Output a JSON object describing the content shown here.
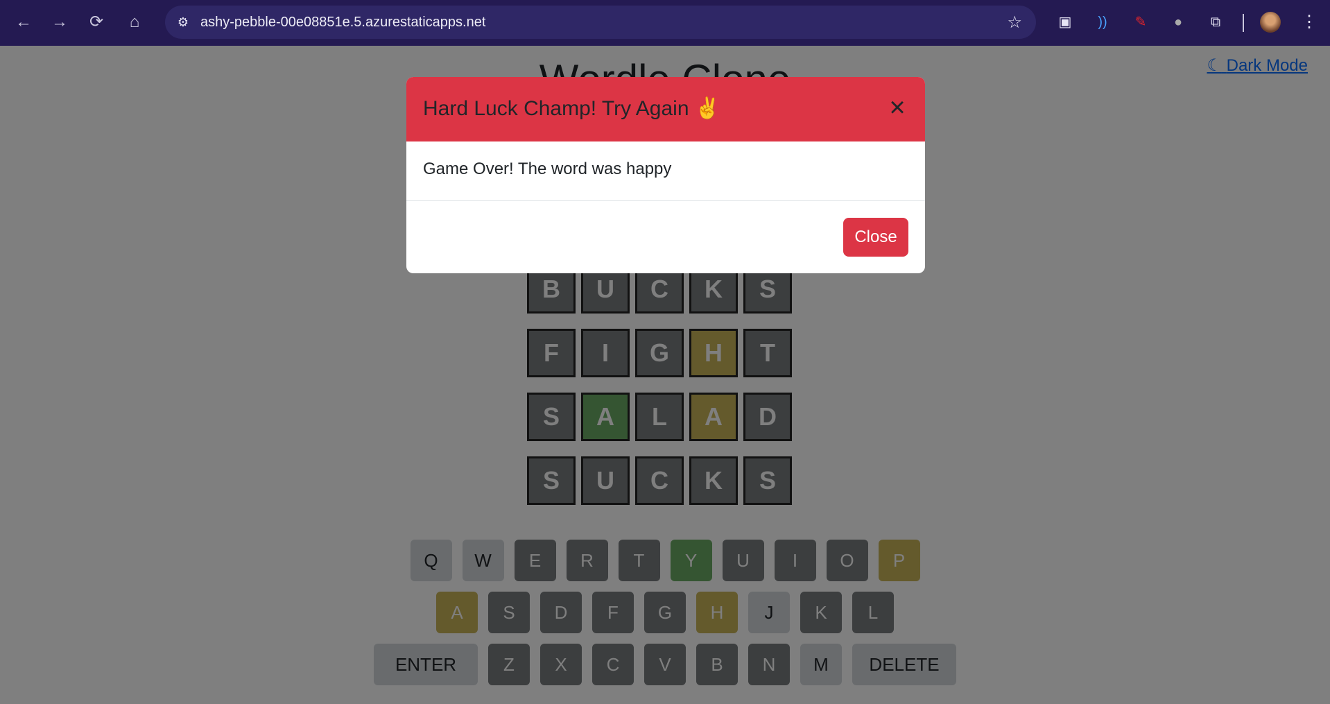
{
  "browser": {
    "url": "ashy-pebble-00e08851e.5.azurestaticapps.net",
    "icons": [
      "back-icon",
      "forward-icon",
      "reload-icon",
      "home-icon",
      "site-info-icon",
      "bookmark-star-icon",
      "picture-in-picture-icon",
      "read-aloud-icon",
      "pen-extension-icon",
      "bug-extension-icon",
      "extensions-puzzle-icon",
      "profile-avatar",
      "menu-kebab-icon"
    ]
  },
  "page": {
    "title": "Wordle Clone",
    "dark_mode_label": "Dark Mode"
  },
  "board": {
    "rows": [
      {
        "letters": [
          "B",
          "U",
          "C",
          "K",
          "S"
        ],
        "states": [
          "absent",
          "absent",
          "absent",
          "absent",
          "absent"
        ]
      },
      {
        "letters": [
          "F",
          "I",
          "G",
          "H",
          "T"
        ],
        "states": [
          "absent",
          "absent",
          "absent",
          "present",
          "absent"
        ]
      },
      {
        "letters": [
          "S",
          "A",
          "L",
          "A",
          "D"
        ],
        "states": [
          "absent",
          "correct",
          "absent",
          "present",
          "absent"
        ]
      },
      {
        "letters": [
          "S",
          "U",
          "C",
          "K",
          "S"
        ],
        "states": [
          "absent",
          "absent",
          "absent",
          "absent",
          "absent"
        ]
      }
    ]
  },
  "keyboard": {
    "rows": [
      [
        {
          "k": "Q",
          "s": "unused"
        },
        {
          "k": "W",
          "s": "unused"
        },
        {
          "k": "E",
          "s": "absent"
        },
        {
          "k": "R",
          "s": "absent"
        },
        {
          "k": "T",
          "s": "absent"
        },
        {
          "k": "Y",
          "s": "correct"
        },
        {
          "k": "U",
          "s": "absent"
        },
        {
          "k": "I",
          "s": "absent"
        },
        {
          "k": "O",
          "s": "absent"
        },
        {
          "k": "P",
          "s": "present"
        }
      ],
      [
        {
          "k": "A",
          "s": "present"
        },
        {
          "k": "S",
          "s": "absent"
        },
        {
          "k": "D",
          "s": "absent"
        },
        {
          "k": "F",
          "s": "absent"
        },
        {
          "k": "G",
          "s": "absent"
        },
        {
          "k": "H",
          "s": "present"
        },
        {
          "k": "J",
          "s": "unused"
        },
        {
          "k": "K",
          "s": "absent"
        },
        {
          "k": "L",
          "s": "absent"
        }
      ],
      [
        {
          "k": "ENTER",
          "s": "unused",
          "wide": true
        },
        {
          "k": "Z",
          "s": "absent"
        },
        {
          "k": "X",
          "s": "absent"
        },
        {
          "k": "C",
          "s": "absent"
        },
        {
          "k": "V",
          "s": "absent"
        },
        {
          "k": "B",
          "s": "absent"
        },
        {
          "k": "N",
          "s": "absent"
        },
        {
          "k": "M",
          "s": "unused"
        },
        {
          "k": "DELETE",
          "s": "unused",
          "wide": true
        }
      ]
    ]
  },
  "modal": {
    "title": "Hard Luck Champ! Try Again ✌",
    "body": "Game Over! The word was happy",
    "close_button": "Close"
  },
  "colors": {
    "modal_header": "#dc3545",
    "tile_correct": "#6aaa64",
    "tile_present": "#c9b458",
    "tile_absent": "#787c7e",
    "chrome_bg": "#241a52"
  }
}
